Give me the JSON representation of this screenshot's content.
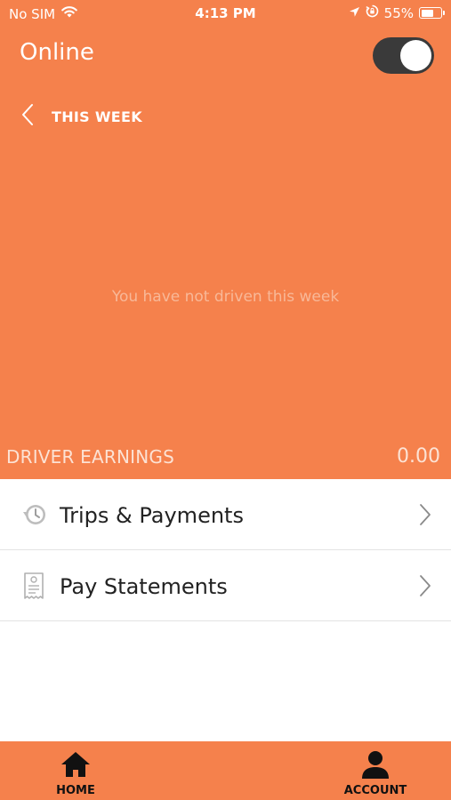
{
  "status_bar": {
    "carrier": "No SIM",
    "time": "4:13 PM",
    "battery": "55%",
    "icons": [
      "wifi-icon",
      "location-arrow-icon",
      "orientation-lock-icon",
      "battery-icon"
    ]
  },
  "header": {
    "title": "Online",
    "online_toggle": {
      "on": true
    }
  },
  "week_nav": {
    "label": "THIS WEEK",
    "icon": "chevron-left-icon"
  },
  "empty_state": {
    "message": "You have not driven this week"
  },
  "earnings": {
    "label": "DRIVER EARNINGS",
    "value": "0.00"
  },
  "menu": {
    "items": [
      {
        "label": "Trips & Payments",
        "icon": "history-clock-icon"
      },
      {
        "label": "Pay Statements",
        "icon": "receipt-icon"
      }
    ]
  },
  "tabbar": {
    "tabs": [
      {
        "label": "HOME",
        "icon": "home-icon"
      },
      {
        "label": "ACCOUNT",
        "icon": "person-icon"
      }
    ]
  },
  "colors": {
    "brand_orange": "#F5814C",
    "toggle_track": "#3A3A3A",
    "text_dark": "#222222"
  }
}
